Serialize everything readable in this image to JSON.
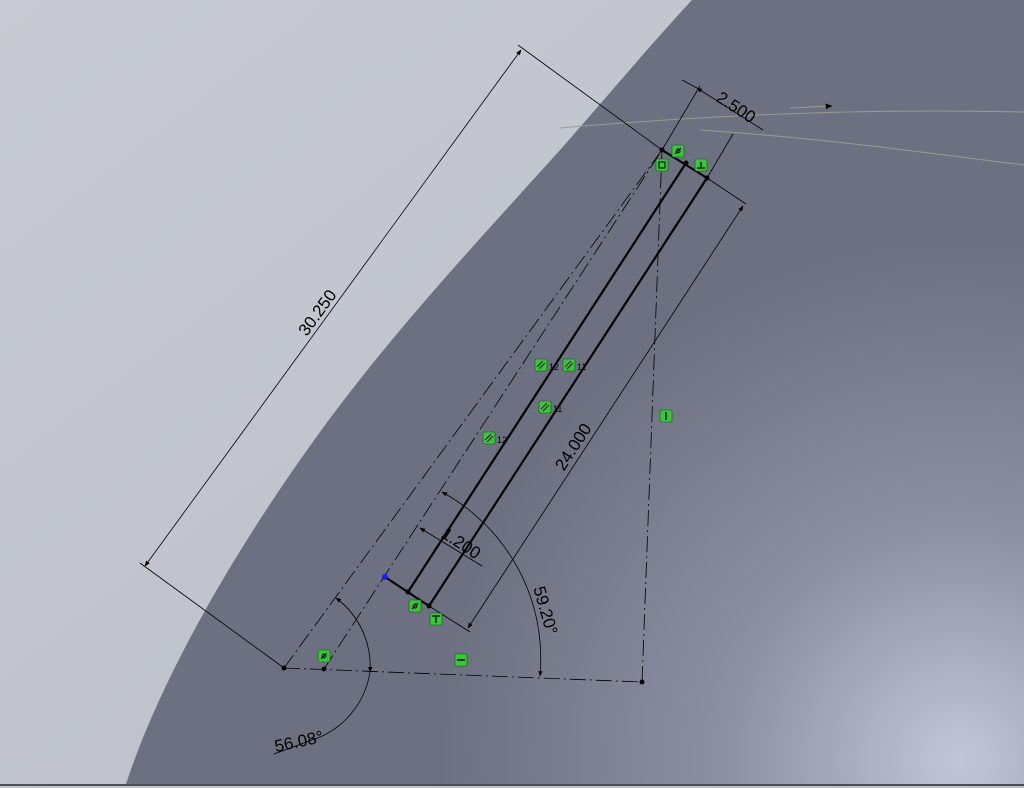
{
  "colors": {
    "background_face": "#6e7283",
    "background_light": "#c4c7cf",
    "sketch_line": "#000000",
    "relation_badge": "#37c837",
    "highlight_point": "#1a1aff"
  },
  "dimensions": {
    "overall_length": "30.250",
    "slot_length": "24.000",
    "top_width": "2.500",
    "inner_offset": "1.200",
    "angle_right": "59.20°",
    "angle_left": "56.08°"
  },
  "relations": {
    "parallel_a": "12",
    "parallel_b": "11",
    "parallel_c": "11",
    "parallel_d": "12"
  },
  "icons": {
    "coincident": "coincident-icon",
    "perpendicular": "perpendicular-icon",
    "horizontal": "horizontal-icon",
    "vertical": "vertical-icon",
    "parallel": "parallel-icon"
  }
}
